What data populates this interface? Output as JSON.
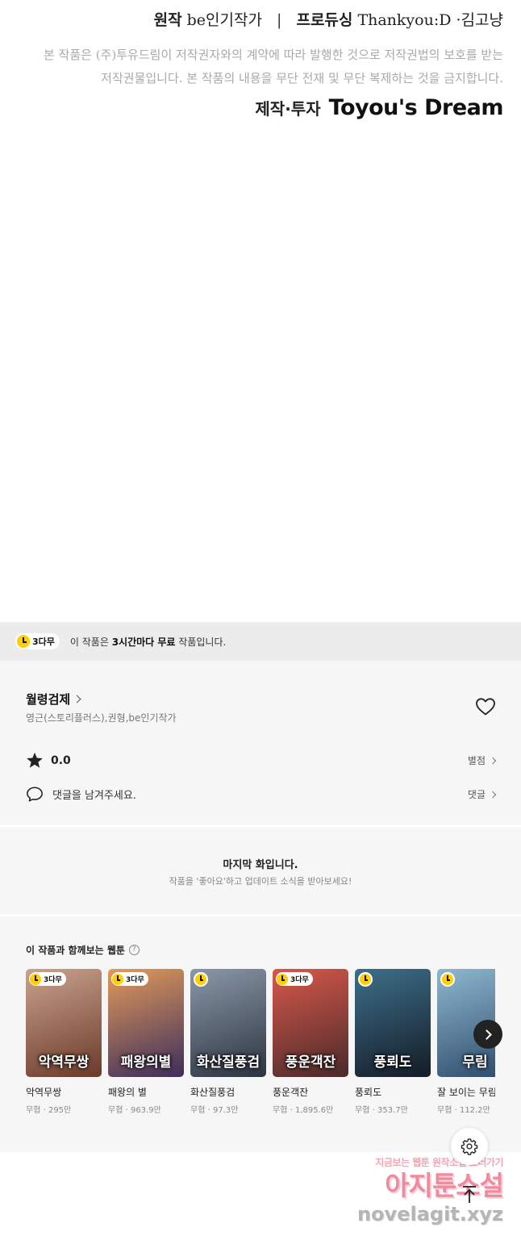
{
  "credits": {
    "original_label": "원작",
    "original_author": "be인기작가",
    "separator": "|",
    "producing_label": "프로듀싱",
    "producers": "Thankyou:D ·김고냥",
    "notice_line1": "본 작품은 (주)투유드림이 저작권자와의 계약에 따라 발행한 것으로 저작권법의 보호를 받는",
    "notice_line2": "저작권물입니다. 본 작품의 내용을 무단 전재 및 무단 복제하는 것을 금지합니다.",
    "production_label": "제작·투자",
    "company_logo": "Toyou's Dream"
  },
  "free_banner": {
    "badge": "3다무",
    "text_prefix": "이 작품은 ",
    "text_bold": "3시간마다 무료",
    "text_suffix": " 작품입니다."
  },
  "work": {
    "title": "월령검제",
    "authors": "영근(스토리플러스),권형,be인기작가",
    "rating": "0.0",
    "rating_link": "별점",
    "comment_prompt": "댓글을 남겨주세요.",
    "comment_link": "댓글"
  },
  "last_episode": {
    "title": "마지막 화입니다.",
    "subtitle": "작품을 '좋아요'하고 업데이트 소식을 받아보세요!"
  },
  "recommendations": {
    "heading": "이 작품과 함께보는 웹툰",
    "help_glyph": "?",
    "items": [
      {
        "title": "악역무쌍",
        "genre": "무협",
        "views": "295만",
        "badge": "3다무",
        "cover_text": "악역무쌍",
        "colors": [
          "#c9a38d",
          "#6b3a2a"
        ]
      },
      {
        "title": "패왕의 별",
        "genre": "무협",
        "views": "963.9만",
        "badge": "3다무",
        "cover_text": "패왕의별",
        "colors": [
          "#e39a5a",
          "#3c2e5c"
        ]
      },
      {
        "title": "화산질풍검",
        "genre": "무협",
        "views": "97.3만",
        "badge": "",
        "cover_text": "화산질풍검",
        "colors": [
          "#8a98a8",
          "#2d3440"
        ]
      },
      {
        "title": "풍운객잔",
        "genre": "무협",
        "views": "1,895.6만",
        "badge": "3다무",
        "cover_text": "풍운객잔",
        "colors": [
          "#d8584a",
          "#4a2a2a"
        ]
      },
      {
        "title": "풍뢰도",
        "genre": "무협",
        "views": "353.7만",
        "badge": "",
        "cover_text": "풍뢰도",
        "colors": [
          "#3d6f8a",
          "#141c26"
        ]
      },
      {
        "title": "잘 보이는 무림 비",
        "genre": "무협",
        "views": "112.2만",
        "badge": "",
        "cover_text": "무림",
        "colors": [
          "#8fb8cf",
          "#2c4a6a"
        ]
      }
    ],
    "meta_separator": " · "
  },
  "watermark": {
    "line1": "지금보는 웹툰 원작소설 보러가기",
    "line2": "아지툰소설",
    "line3": "novelagit.xyz"
  },
  "colors": {
    "accent_yellow": "#ffcf00",
    "banner_bg": "#ececec",
    "section_bg": "#f6f6f6"
  }
}
